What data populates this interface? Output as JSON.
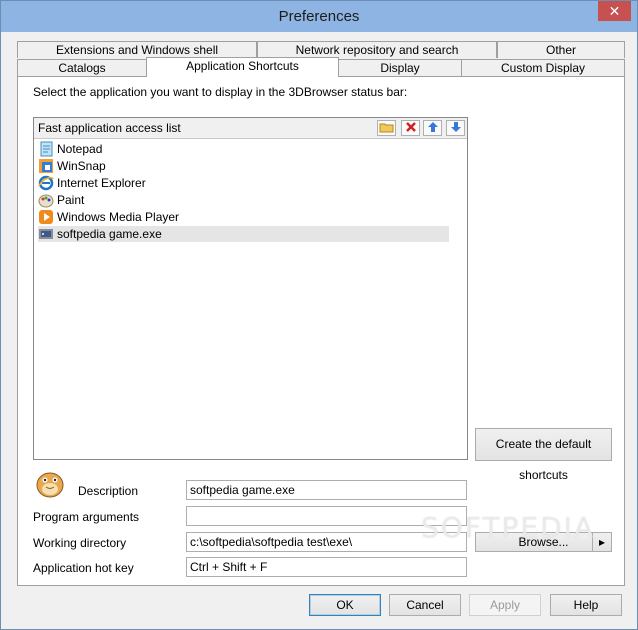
{
  "window": {
    "title": "Preferences",
    "close_glyph": "✕"
  },
  "tabs": {
    "row1": [
      "Extensions and Windows shell",
      "Network repository and search",
      "Other"
    ],
    "row2": [
      "Catalogs",
      "Application Shortcuts",
      "Display",
      "Custom Display"
    ],
    "active": "Application Shortcuts"
  },
  "instruction": "Select the application you want to display in the 3DBrowser status bar:",
  "list": {
    "header": "Fast application access list",
    "toolbar_icons": [
      "folder-icon",
      "delete-icon",
      "move-up-icon",
      "move-down-icon"
    ],
    "items": [
      {
        "label": "Notepad",
        "icon": "notepad-icon"
      },
      {
        "label": "WinSnap",
        "icon": "winsnap-icon"
      },
      {
        "label": "Internet Explorer",
        "icon": "internet-explorer-icon"
      },
      {
        "label": "Paint",
        "icon": "paint-icon"
      },
      {
        "label": "Windows Media Player",
        "icon": "media-player-icon"
      },
      {
        "label": "softpedia game.exe",
        "icon": "game-icon",
        "selected": true
      }
    ]
  },
  "buttons": {
    "create_defaults": "Create the default shortcuts",
    "browse": "Browse...",
    "browse_arrow": "▸",
    "ok": "OK",
    "cancel": "Cancel",
    "apply": "Apply",
    "help": "Help"
  },
  "form": {
    "description_label": "Description",
    "description_value": "softpedia game.exe",
    "arguments_label": "Program arguments",
    "arguments_value": "",
    "workdir_label": "Working directory",
    "workdir_value": "c:\\softpedia\\softpedia test\\exe\\",
    "hotkey_label": "Application hot key",
    "hotkey_value": "Ctrl + Shift + F"
  },
  "watermark": "SOFTPEDIA",
  "colors": {
    "titlebar": "#8db4e3",
    "close": "#c75050",
    "selection": "#e5e5e5"
  }
}
